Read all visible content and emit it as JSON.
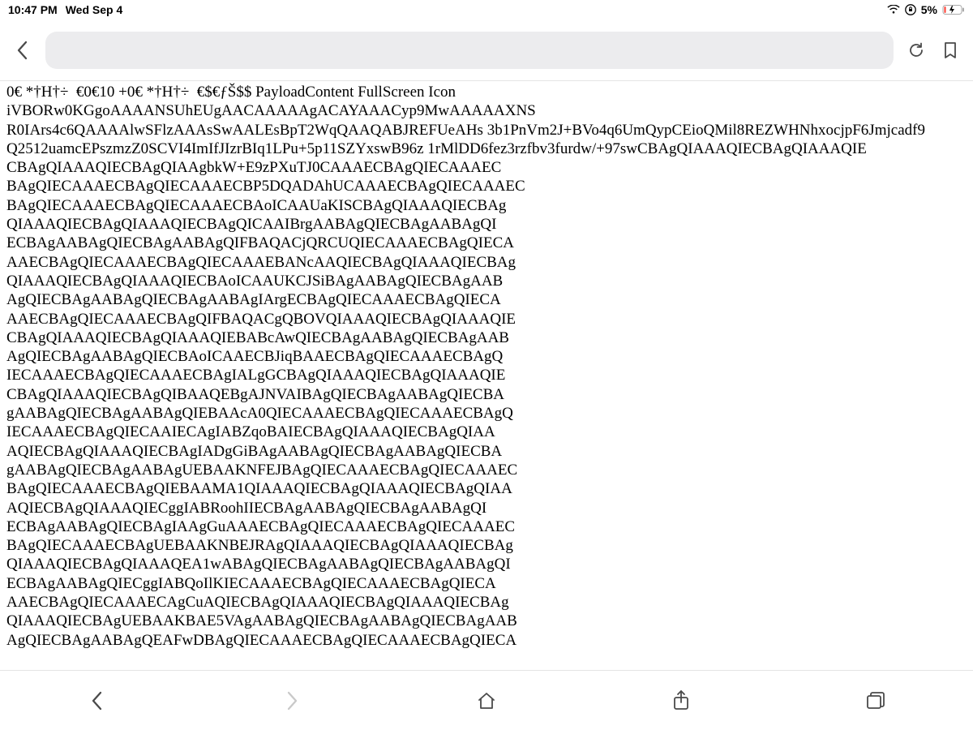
{
  "status": {
    "time": "10:47 PM",
    "date": "Wed Sep 4",
    "battery_pct": "5%"
  },
  "chrome": {
    "address": ""
  },
  "page": {
    "body_text": "0€ *†H†÷  €0€10 +0€ *†H†÷  €$€ƒŠ$$ PayloadContent FullScreen Icon\niVBORw0KGgoAAAANSUhEUgAACAAAAAgACAYAAACyp9MwAAAAAXNS\nR0IArs4c6QAAAAlwSFlzAAAsSwAALEsBpT2WqQAAQABJREFUeAHs 3b1PnVm2J+BVo4q6UmQypCEioQMil8REZWHNhxocjpF6Jmjcadf9\nQ2512uamcEPszmzZ0SCVI4ImIfJIzrBIq1LPu+5p11SZYxswB96z 1rMlDD6fez3rzfbv3furdw/+97swCBAgQIAAAQIECBAgQIAAAQIE\nCBAgQIAAAQIECBAgQIAAgbkW+E9zPXuTJ0CAAAECBAgQIECAAAEC\nBAgQIECAAAECBAgQIECAAAECBP5DQADAhUCAAAECBAgQIECAAAEC\nBAgQIECAAAECBAgQIECAAAECBAoICAAUaKISCBAgQIAAAQIECBAg\nQIAAAQIECBAgQIAAAQIECBAgQICAAIBrgAABAgQIECBAgAABAgQI\nECBAgAABAgQIECBAgAABAgQIFBAQACjQRCUQIECAAAECBAgQIECA\nAAECBAgQIECAAAECBAgQIECAAAEBANcAAQIECBAgQIAAAQIECBAg\nQIAAAQIECBAgQIAAAQIECBAoICAAUKCJSiBAgAABAgQIECBAgAAB\nAgQIECBAgAABAgQIECBAgAABAgIArgECBAgQIECAAAECBAgQIECA\nAAECBAgQIECAAAECBAgQIFBAQACgQBOVQIAAAQIECBAgQIAAAQIE\nCBAgQIAAAQIECBAgQIAAAQIEBABcAwQIECBAgAABAgQIECBAgAAB\nAgQIECBAgAABAgQIECBAoICAAECBJiqBAAECBAgQIECAAAECBAgQ\nIECAAAECBAgQIECAAAECBAgIALgGCBAgQIAAAQIECBAgQIAAAQIE\nCBAgQIAAAQIECBAgQIBAAQEBgAJNVAIBAgQIECBAgAABAgQIECBA\ngAABAgQIECBAgAABAgQIEBAAcA0QIECAAAECBAgQIECAAAECBAgQ\nIECAAAECBAgQIECAAIECAgIABZqoBAIECBAgQIAAAQIECBAgQIAA\nAQIECBAgQIAAAQIECBAgIADgGiBAgAABAgQIECBAgAABAgQIECBA\ngAABAgQIECBAgAABAgUEBAAKNFEJBAgQIECAAAECBAgQIECAAAEC\nBAgQIECAAAECBAgQIEBAAMA1QIAAAQIECBAgQIAAAQIECBAgQIAA\nAQIECBAgQIAAAQIECggIABRoohIIECBAgAABAgQIECBAgAABAgQI\nECBAgAABAgQIECBAgIAAgGuAAAECBAgQIECAAAECBAgQIECAAAEC\nBAgQIECAAAECBAgUEBAAKNBEJRAgQIAAAQIECBAgQIAAAQIECBAg\nQIAAAQIECBAgQIAAAQEA1wABAgQIECBAgAABAgQIECBAgAABAgQI\nECBAgAABAgQIECggIABQoIlKIECAAAECBAgQIECAAAECBAgQIECA\nAAECBAgQIECAAAECAgCuAQIECBAgQIAAAQIECBAgQIAAAQIECBAg\nQIAAAQIECBAgUEBAAKBAE5VAgAABAgQIECBAgAABAgQIECBAgAAB\nAgQIECBAgAABAgQEAFwDBAgQIECAAAECBAgQIECAAAECBAgQIECA"
  }
}
